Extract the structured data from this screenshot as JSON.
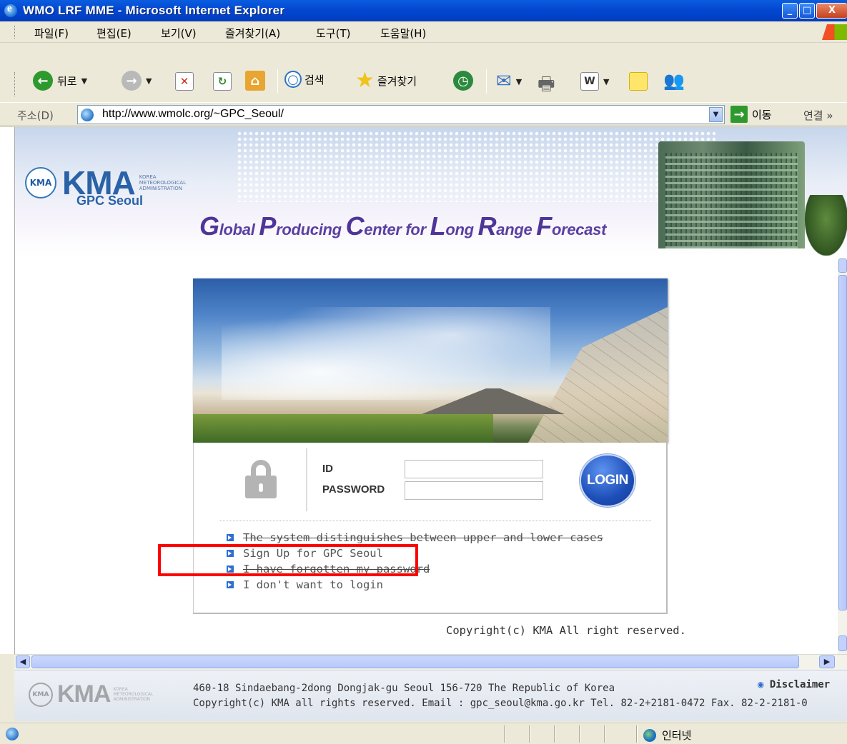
{
  "window": {
    "title": "WMO LRF MME - Microsoft Internet Explorer",
    "controls": {
      "minimize": "_",
      "maximize": "□",
      "close": "X"
    }
  },
  "menu": [
    "파일(F)",
    "편집(E)",
    "보기(V)",
    "즐겨찾기(A)",
    "도구(T)",
    "도움말(H)"
  ],
  "toolbar": {
    "back": "뒤로",
    "search": "검색",
    "favorites": "즐겨찾기"
  },
  "address": {
    "label": "주소(D)",
    "url": "http://www.wmolc.org/~GPC_Seoul/",
    "go": "이동",
    "links": "연결 »"
  },
  "banner": {
    "logo": "KMA",
    "logo_small": "KOREA METEOROLOGICAL ADMINISTRATION",
    "subtitle": "GPC Seoul",
    "tagline_parts": [
      {
        "cap": "G",
        "rest": "lobal "
      },
      {
        "cap": "P",
        "rest": "roducing "
      },
      {
        "cap": "C",
        "rest": "enter for "
      },
      {
        "cap": "L",
        "rest": "ong "
      },
      {
        "cap": "R",
        "rest": "ange "
      },
      {
        "cap": "F",
        "rest": "orecast"
      }
    ]
  },
  "login": {
    "id_label": "ID",
    "password_label": "PASSWORD",
    "id_value": "",
    "password_value": "",
    "button": "LOGIN",
    "notices": [
      "The system distinguishes between upper and lower cases",
      "Sign Up for GPC Seoul",
      "I have forgotten my password",
      "I don't want to login"
    ]
  },
  "copyright": "Copyright(c) KMA All right reserved.",
  "footer": {
    "logo": "KMA",
    "logo_small": "KOREA METEOROLOGICAL ADMINISTRATION",
    "address": "460-18 Sindaebang-2dong Dongjak-gu Seoul 156-720 The Republic of Korea",
    "copyright": "Copyright(c) KMA all rights reserved. Email : gpc_seoul@kma.go.kr Tel. 82-2+2181-0472 Fax. 82-2-2181-0",
    "disclaimer": "Disclaimer"
  },
  "status": {
    "zone": "인터넷"
  },
  "colors": {
    "titlebar": "#0347d0",
    "highlight": "#ff0000",
    "login_button": "#1d4fb8",
    "tagline": "#5a3fa2"
  }
}
